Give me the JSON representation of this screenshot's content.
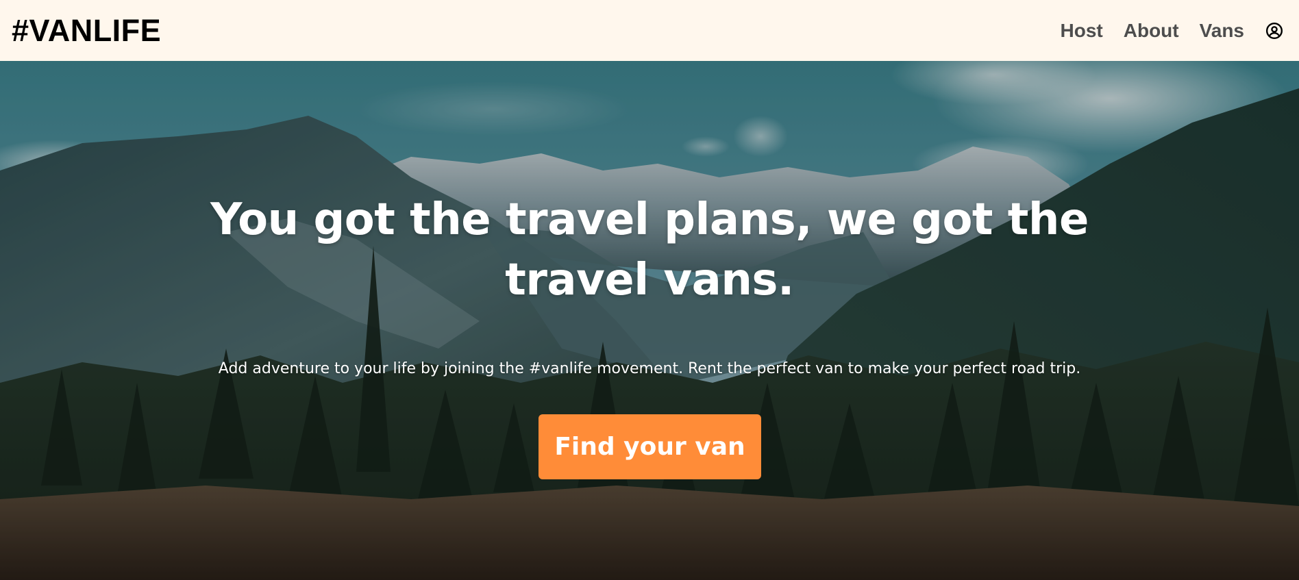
{
  "header": {
    "brand": "#VANLIFE",
    "nav": [
      {
        "label": "Host"
      },
      {
        "label": "About"
      },
      {
        "label": "Vans"
      }
    ],
    "account_icon": "user-circle-icon"
  },
  "hero": {
    "title": "You got the travel plans, we got the travel vans.",
    "subtitle": "Add adventure to your life by joining the #vanlife movement. Rent the perfect van to make your perfect road trip.",
    "cta_label": "Find your van"
  },
  "colors": {
    "header_bg": "#fff7ed",
    "brand_text": "#000000",
    "nav_text": "#4d4d4d",
    "cta_bg": "#ff8c38",
    "cta_text": "#ffffff",
    "hero_text": "#ffffff"
  }
}
